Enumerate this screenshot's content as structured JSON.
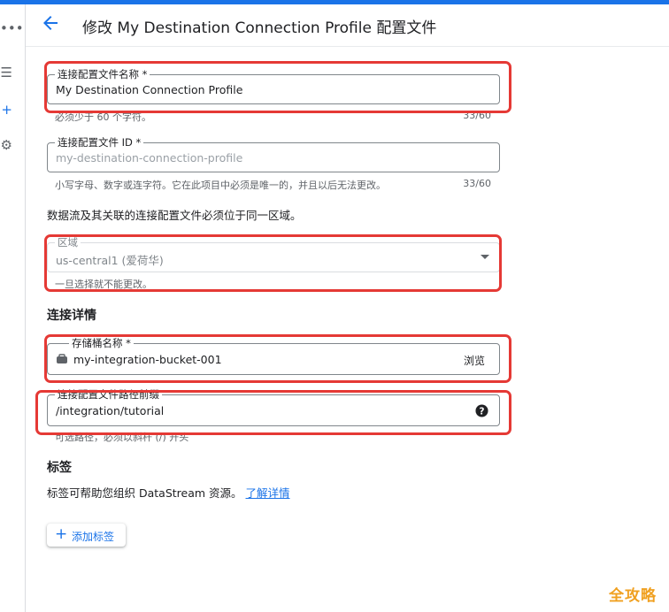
{
  "header": {
    "title": "修改 My Destination Connection Profile 配置文件"
  },
  "profile_name": {
    "label": "连接配置文件名称 *",
    "value": "My Destination Connection Profile",
    "hint": "必须少于 60 个字符。",
    "count": "33/60"
  },
  "profile_id": {
    "label": "连接配置文件 ID *",
    "placeholder": "my-destination-connection-profile",
    "hint": "小写字母、数字或连字符。它在此项目中必须是唯一的，并且以后无法更改。",
    "count": "33/60"
  },
  "region_note": "数据流及其关联的连接配置文件必须位于同一区域。",
  "region": {
    "label": "区域",
    "value": "us-central1 (爱荷华)",
    "hint": "一旦选择就不能更改。"
  },
  "details": {
    "title": "连接详情"
  },
  "bucket": {
    "label": "存储桶名称 *",
    "value": "my-integration-bucket-001",
    "browse_label": "浏览"
  },
  "path_prefix": {
    "label": "连接配置文件路径前缀",
    "value": "/integration/tutorial",
    "hint": "可选路径，必须以斜杆 (/) 开头"
  },
  "labels": {
    "title": "标签",
    "description": "标签可帮助您组织 DataStream 资源。",
    "learn_more": "了解详情",
    "add_button": "添加标签"
  },
  "watermark": "全攻略",
  "colors": {
    "accent": "#1a73e8",
    "highlight": "#e53935"
  }
}
